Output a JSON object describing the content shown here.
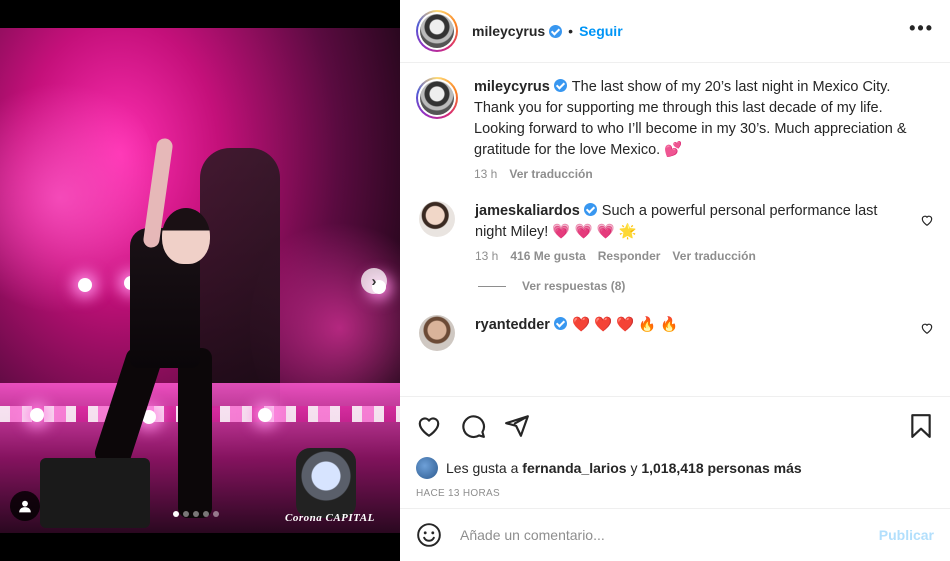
{
  "post": {
    "owner": "mileycyrus",
    "follow_label": "Seguir",
    "bullet": "•",
    "more_label": "•••",
    "next_label": "›",
    "carousel_dots": 5,
    "watermark": "Corona CAPITAL"
  },
  "caption": {
    "username": "mileycyrus",
    "text": "The last show of my 20’s last night in Mexico City. Thank you for supporting me through this last decade of my life. Looking forward to who I’ll become in my 30’s. Much appreciation & gratitude for the love Mexico. 💕",
    "time": "13 h",
    "translate": "Ver traducción"
  },
  "comments": [
    {
      "username": "jameskaliardos",
      "text": "Such a powerful personal performance last night Miley! 💗 💗 💗 🌟",
      "time": "13 h",
      "likes": "416 Me gusta",
      "reply": "Responder",
      "translate": "Ver traducción",
      "view_replies": "Ver respuestas (8)"
    },
    {
      "username": "ryantedder",
      "text": "❤️ ❤️ ❤️ 🔥 🔥"
    }
  ],
  "likes": {
    "prefix": "Les gusta a",
    "user": "fernanda_larios",
    "connector": "y",
    "count": "1,018,418 personas más"
  },
  "time_ago": "HACE 13 HORAS",
  "add_comment": {
    "placeholder": "Añade un comentario...",
    "publish": "Publicar"
  },
  "colors": {
    "accent": "#0095f6",
    "publish_disabled": "#b2dffc",
    "muted": "#8e8e8e",
    "text": "#262626",
    "verified": "#3897f0"
  }
}
